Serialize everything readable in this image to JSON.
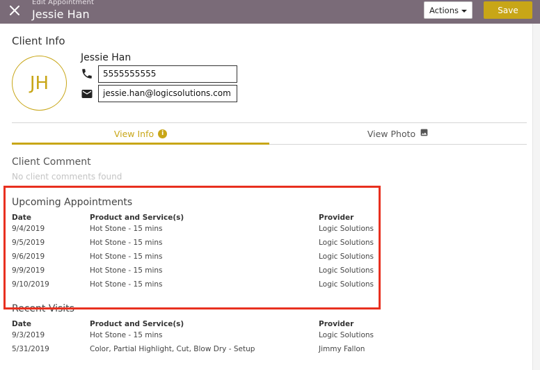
{
  "header": {
    "subtitle": "Edit Appointment",
    "title": "Jessie Han",
    "actions_label": "Actions",
    "save_label": "Save"
  },
  "client_info": {
    "section_title": "Client Info",
    "initials": "JH",
    "name": "Jessie Han",
    "phone": "5555555555",
    "email": "jessie.han@logicsolutions.com"
  },
  "tabs": [
    {
      "label": "View Info",
      "icon": "info-icon",
      "active": true
    },
    {
      "label": "View Photo",
      "icon": "image-icon",
      "active": false
    }
  ],
  "client_comment": {
    "title": "Client Comment",
    "empty_text": "No client comments found"
  },
  "columns": {
    "date": "Date",
    "product": "Product and Service(s)",
    "provider": "Provider"
  },
  "upcoming": {
    "title": "Upcoming Appointments",
    "rows": [
      {
        "date": "9/4/2019",
        "product": "Hot Stone - 15 mins",
        "provider": "Logic Solutions"
      },
      {
        "date": "9/5/2019",
        "product": "Hot Stone - 15 mins",
        "provider": "Logic Solutions"
      },
      {
        "date": "9/6/2019",
        "product": "Hot Stone - 15 mins",
        "provider": "Logic Solutions"
      },
      {
        "date": "9/9/2019",
        "product": "Hot Stone - 15 mins",
        "provider": "Logic Solutions"
      },
      {
        "date": "9/10/2019",
        "product": "Hot Stone - 15 mins",
        "provider": "Logic Solutions"
      }
    ]
  },
  "recent": {
    "title": "Recent Visits",
    "rows": [
      {
        "date": "9/3/2019",
        "product": "Hot Stone - 15 mins",
        "provider": "Logic Solutions"
      },
      {
        "date": "5/31/2019",
        "product": "Color, Partial Highlight, Cut, Blow Dry - Setup",
        "provider": "Jimmy Fallon"
      }
    ]
  },
  "colors": {
    "header_bg": "#7a6b78",
    "accent": "#c8a617",
    "highlight": "#e8301f"
  }
}
